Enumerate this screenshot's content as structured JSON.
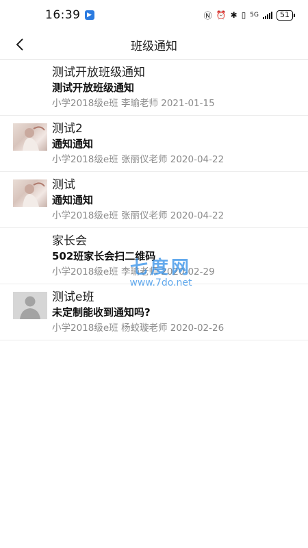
{
  "status_bar": {
    "time": "16:39",
    "network": "5G",
    "battery": "51",
    "icons": [
      "nfc-icon",
      "alarm-icon",
      "bluetooth-icon",
      "vibrate-icon",
      "signal-icon"
    ]
  },
  "navbar": {
    "title": "班级通知",
    "back_icon": "chevron-left-icon"
  },
  "notices": [
    {
      "title": "测试开放班级通知",
      "subtitle": "测试开放班级通知",
      "meta": "小学2018级e班 李瑜老师 2021-01-15",
      "thumbnail": "none"
    },
    {
      "title": "测试2",
      "subtitle": "通知通知",
      "meta": "小学2018级e班 张丽仪老师 2020-04-22",
      "thumbnail": "photo"
    },
    {
      "title": "测试",
      "subtitle": "通知通知",
      "meta": "小学2018级e班 张丽仪老师 2020-04-22",
      "thumbnail": "photo"
    },
    {
      "title": "家长会",
      "subtitle": "502班家长会扫二维码",
      "meta": "小学2018级e班 李瑜老师 2020-02-29",
      "thumbnail": "none"
    },
    {
      "title": "测试e班",
      "subtitle": "未定制能收到通知吗?",
      "meta": "小学2018级e班 杨蛟璇老师 2020-02-26",
      "thumbnail": "avatar"
    }
  ],
  "watermark": {
    "title": "七度网",
    "url": "www.7do.net"
  }
}
